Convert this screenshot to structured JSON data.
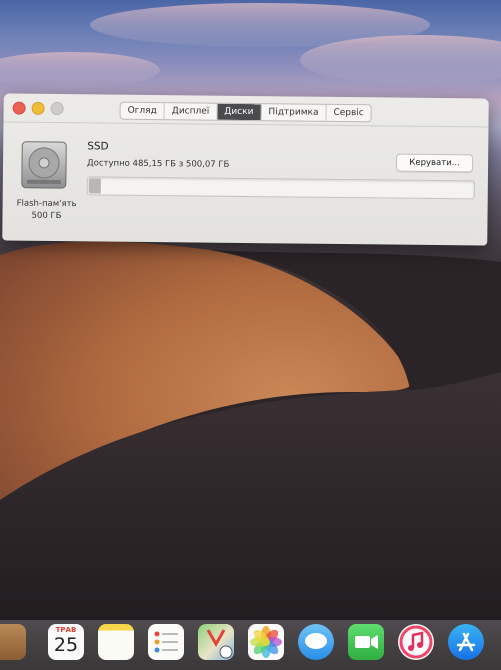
{
  "window": {
    "tabs": [
      {
        "label": "Огляд"
      },
      {
        "label": "Дисплеї"
      },
      {
        "label": "Диски"
      },
      {
        "label": "Підтримка"
      },
      {
        "label": "Сервіс"
      }
    ],
    "active_tab": "Диски"
  },
  "disk": {
    "name": "Flash-пам'ять",
    "capacity": "500 ГБ",
    "title": "SSD",
    "available": "Доступно 485,15 ГБ з 500,07 ГБ",
    "used_fraction": 0.03,
    "manage_label": "Керувати..."
  },
  "dock": {
    "calendar_month": "ТРАВ",
    "calendar_day": "25",
    "icons": [
      "contacts-icon",
      "calendar-icon",
      "notes-icon",
      "reminders-icon",
      "maps-icon",
      "photos-icon",
      "messages-icon",
      "facetime-icon",
      "itunes-icon",
      "app-store-icon"
    ]
  },
  "colors": {
    "close": "#ec5f56",
    "minimize": "#f0bd3b",
    "active_tab": "#4b4a4c"
  }
}
